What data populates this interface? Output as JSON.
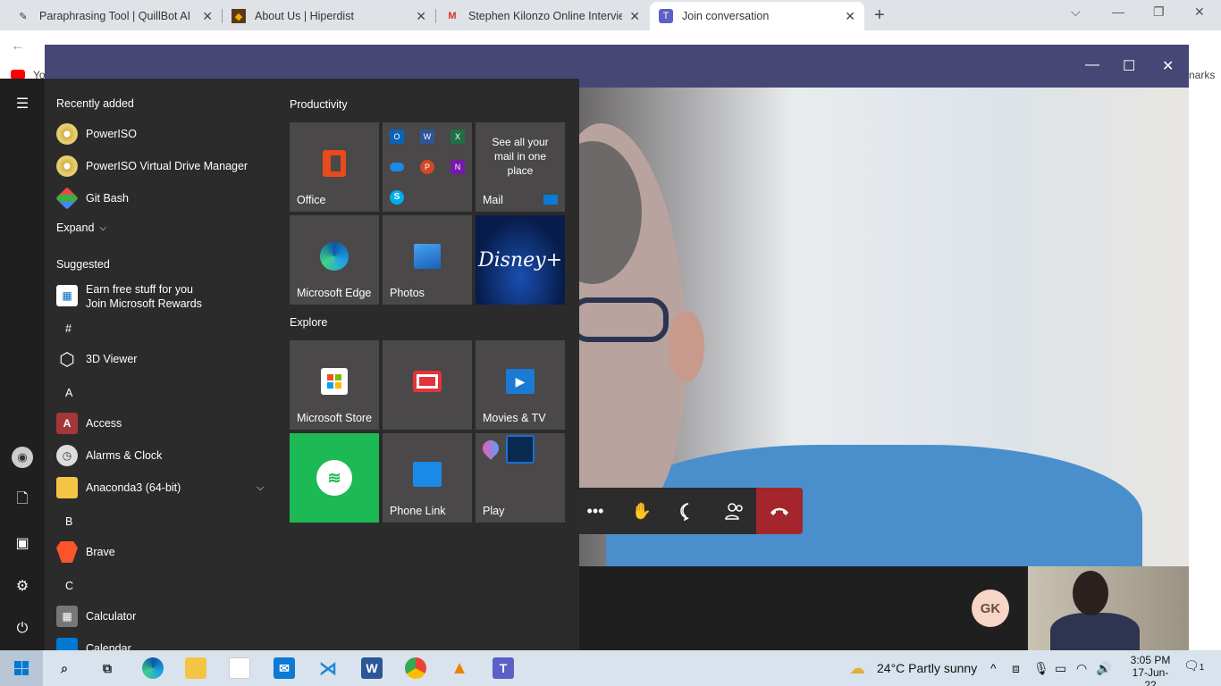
{
  "browser": {
    "tabs": [
      {
        "title": "Paraphrasing Tool | QuillBot AI",
        "icon": "quillbot-icon"
      },
      {
        "title": "About Us | Hiperdist",
        "icon": "hiperdist-icon"
      },
      {
        "title": "Stephen Kilonzo Online Interview",
        "icon": "gmail-icon"
      },
      {
        "title": "Join conversation",
        "icon": "teams-icon"
      }
    ],
    "new_tab": "+",
    "bookmarks_partial_left": "Yo",
    "bookmarks_partial_right": "narks"
  },
  "start_menu": {
    "recently_added_heading": "Recently added",
    "recent": [
      "PowerISO",
      "PowerISO Virtual Drive Manager",
      "Git Bash"
    ],
    "expand_label": "Expand",
    "suggested_heading": "Suggested",
    "suggested_line1": "Earn free stuff for you",
    "suggested_line2": "Join Microsoft Rewards",
    "letter_hash": "#",
    "app_3dviewer": "3D Viewer",
    "letter_a": "A",
    "app_access": "Access",
    "app_alarms": "Alarms & Clock",
    "app_anaconda": "Anaconda3 (64-bit)",
    "letter_b": "B",
    "app_brave": "Brave",
    "letter_c": "C",
    "app_calculator": "Calculator",
    "app_calendar": "Calendar",
    "productivity_heading": "Productivity",
    "explore_heading": "Explore",
    "tiles": {
      "office": "Office",
      "mail_promo": "See all your mail in one place",
      "mail": "Mail",
      "edge": "Microsoft Edge",
      "photos": "Photos",
      "disney": "Disney+",
      "store": "Microsoft Store",
      "movies": "Movies & TV",
      "phone_link": "Phone Link",
      "play": "Play"
    }
  },
  "meeting": {
    "avatar_initials": "GK"
  },
  "taskbar": {
    "weather": "24°C  Partly sunny",
    "time": "3:05 PM",
    "date": "17-Jun-22",
    "notifications": "1"
  }
}
